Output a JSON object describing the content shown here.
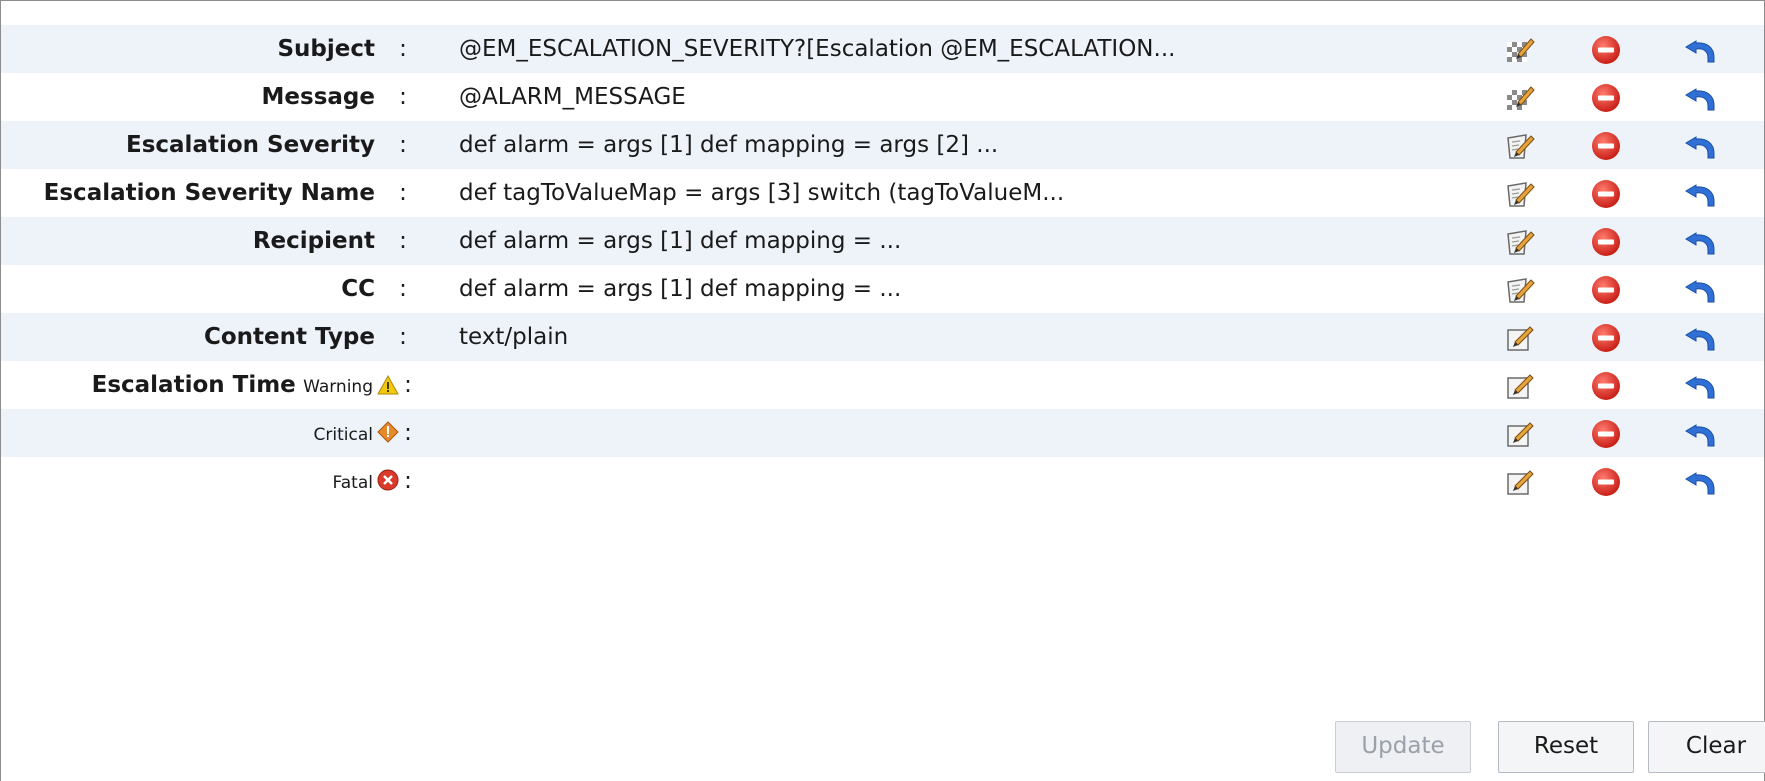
{
  "rows": [
    {
      "label": "Subject",
      "value": "@EM_ESCALATION_SEVERITY?[Escalation @EM_ESCALATION...",
      "edit_icon": "expression-editor-icon"
    },
    {
      "label": "Message",
      "value": "@ALARM_MESSAGE",
      "edit_icon": "expression-editor-icon"
    },
    {
      "label": "Escalation Severity",
      "value": "def alarm = args [1] def mapping = args [2] ...",
      "edit_icon": "script-editor-icon"
    },
    {
      "label": "Escalation Severity Name",
      "value": "def tagToValueMap = args [3] switch (tagToValueM...",
      "edit_icon": "script-editor-icon"
    },
    {
      "label": "Recipient",
      "value": "def alarm = args [1] def mapping = ...",
      "edit_icon": "script-editor-icon"
    },
    {
      "label": "CC",
      "value": "def alarm = args [1] def mapping = ...",
      "edit_icon": "script-editor-icon"
    },
    {
      "label": "Content Type",
      "value": "text/plain",
      "edit_icon": "edit-icon"
    }
  ],
  "escalation_time": {
    "label": "Escalation Time",
    "levels": [
      {
        "name": "Warning",
        "icon": "warning-icon",
        "value": ""
      },
      {
        "name": "Critical",
        "icon": "critical-icon",
        "value": ""
      },
      {
        "name": "Fatal",
        "icon": "fatal-icon",
        "value": ""
      }
    ]
  },
  "separator": ":",
  "buttons": {
    "update": "Update",
    "reset": "Reset",
    "clear": "Clear"
  },
  "colors": {
    "row_shade": "#eef3fa",
    "remove_red": "#e53935",
    "undo_blue": "#2f6fd6",
    "warning_yellow": "#f2c811",
    "critical_orange": "#e8892a",
    "fatal_red": "#d93a2b"
  }
}
